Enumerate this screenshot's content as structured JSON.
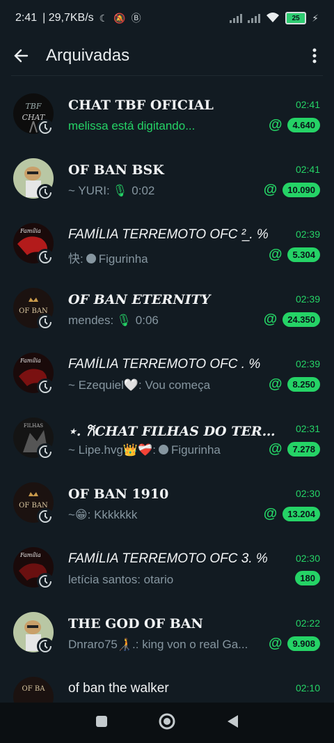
{
  "status": {
    "time": "2:41",
    "network": "| 29,7KB/s",
    "battery": "25"
  },
  "header": {
    "title": "Arquivadas"
  },
  "chats": [
    {
      "title": "CHAT TBF OFICIAL",
      "time": "02:41",
      "subtitle": "melissa está digitando...",
      "count": "4.640",
      "mention": true,
      "avatar": "chat-tbf-avatar"
    },
    {
      "title": "OF BAN BSK",
      "time": "02:41",
      "subtitle_sender": "~ YURI:",
      "subtitle_text": "0:02",
      "count": "10.090",
      "mention": true,
      "avatar": "bsk-avatar"
    },
    {
      "title": "FAMÍLIA TERREMOTO OFC ²̲ . %",
      "time": "02:39",
      "subtitle_sender": "快:",
      "subtitle_text": "Figurinha",
      "count": "5.304",
      "mention": true,
      "avatar": "familia-avatar"
    },
    {
      "title": "OF BAN ETERNITY",
      "time": "02:39",
      "subtitle_sender": "mendes:",
      "subtitle_text": "0:06",
      "count": "24.350",
      "mention": true,
      "avatar": "ofban-crown-avatar"
    },
    {
      "title": "FAMÍLIA TERREMOTO OFC . %",
      "time": "02:39",
      "subtitle": "~ Ezequiel🤍: Vou começa",
      "count": "8.250",
      "mention": true,
      "avatar": "familia-avatar"
    },
    {
      "title": "⋆. 𐙚CHAT FILHAS DO TERREM...",
      "time": "02:31",
      "subtitle_sender": "~ Lipe.hvg👑❤️‍🩹:",
      "subtitle_text": "Figurinha",
      "count": "7.278",
      "mention": true,
      "avatar": "filhas-avatar"
    },
    {
      "title": "OF BAN 1910",
      "time": "02:30",
      "subtitle": "~😁: Kkkkkkk",
      "count": "13.204",
      "mention": true,
      "avatar": "ofban-crown-avatar"
    },
    {
      "title": "FAMÍLIA TERREMOTO OFC 3. %",
      "time": "02:30",
      "subtitle": "letícia santos: otario",
      "count": "180",
      "mention": false,
      "avatar": "familia-avatar"
    },
    {
      "title": "THE GOD OF BAN",
      "time": "02:22",
      "subtitle": "Dnraro75🧑‍🦯.: king von o real Ga...",
      "count": "9.908",
      "mention": true,
      "avatar": "bsk-avatar"
    },
    {
      "title": "of ban the walker",
      "time": "02:10",
      "subtitle": "",
      "count": "",
      "mention": false,
      "avatar": "ofban-crown-avatar"
    }
  ],
  "icons": {
    "back": "back-arrow-icon",
    "menu": "more-vertical-icon",
    "archive": "archive-clock-icon",
    "mention": "at-mention-icon"
  },
  "colors": {
    "background": "#121b22",
    "accent": "#25d366",
    "muted": "#8696a0"
  }
}
